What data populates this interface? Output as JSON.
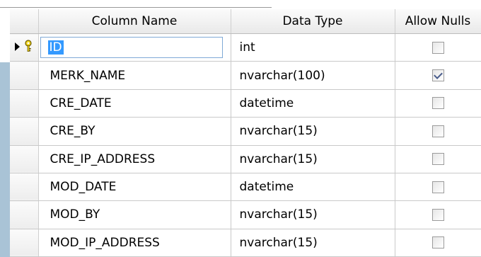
{
  "header": {
    "column_name": "Column Name",
    "data_type": "Data Type",
    "allow_nulls": "Allow Nulls"
  },
  "rows": [
    {
      "name": "ID",
      "type": "int",
      "allow_nulls": false,
      "primary_key": true,
      "editing": true
    },
    {
      "name": "MERK_NAME",
      "type": "nvarchar(100)",
      "allow_nulls": true
    },
    {
      "name": "CRE_DATE",
      "type": "datetime",
      "allow_nulls": false
    },
    {
      "name": "CRE_BY",
      "type": "nvarchar(15)",
      "allow_nulls": false
    },
    {
      "name": "CRE_IP_ADDRESS",
      "type": "nvarchar(15)",
      "allow_nulls": false
    },
    {
      "name": "MOD_DATE",
      "type": "datetime",
      "allow_nulls": false
    },
    {
      "name": "MOD_BY",
      "type": "nvarchar(15)",
      "allow_nulls": false
    },
    {
      "name": "MOD_IP_ADDRESS",
      "type": "nvarchar(15)",
      "allow_nulls": false
    }
  ],
  "icons": {
    "row_selector": "current-row-arrow-icon",
    "primary_key": "primary-key-icon"
  },
  "colors": {
    "selection": "#3399ff",
    "checkmark": "#4a5d8c",
    "side_panel": "#a9c3d6"
  }
}
